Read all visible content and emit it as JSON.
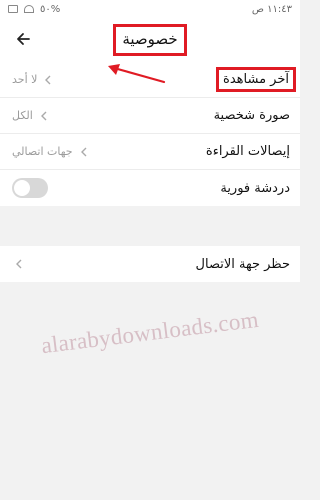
{
  "status_bar": {
    "time": "١١:٤٣ ص",
    "battery": "٥٠%"
  },
  "header": {
    "title": "خصوصية",
    "back_icon": "arrow-left-icon"
  },
  "settings": [
    {
      "label": "آخر مشاهدة",
      "value": "لا أحد"
    },
    {
      "label": "صورة شخصية",
      "value": "الكل"
    },
    {
      "label": "إيصالات القراءة",
      "value": "جهات اتصالي"
    },
    {
      "label": "دردشة فورية",
      "toggle": false
    }
  ],
  "block": {
    "label": "حظر جهة الاتصال"
  },
  "watermark": "alarabydownloads.com",
  "colors": {
    "highlight": "#e01b24",
    "background": "#f2f2f2",
    "toggle_off": "#d8d8d8"
  }
}
